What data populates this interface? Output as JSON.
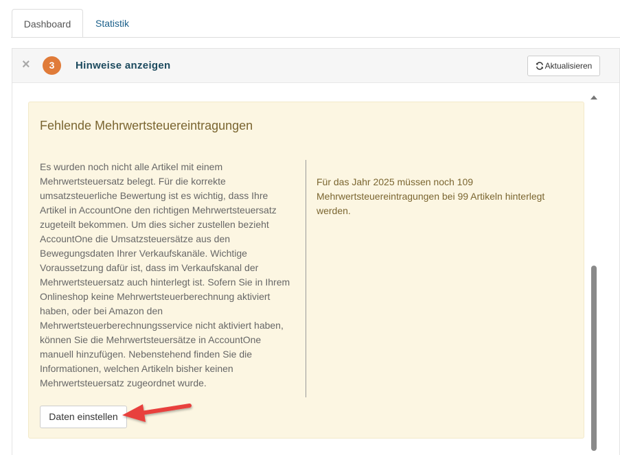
{
  "tabs": [
    {
      "label": "Dashboard",
      "active": true
    },
    {
      "label": "Statistik",
      "active": false
    }
  ],
  "panel": {
    "close_icon": "×",
    "badge_count": "3",
    "title": "Hinweise anzeigen",
    "refresh_label": "Aktualisieren"
  },
  "notice": {
    "title": "Fehlende Mehrwertsteuereintragungen",
    "body": "Es wurden noch nicht alle Artikel mit einem Mehrwertsteuersatz belegt. Für die korrekte umsatzsteuerliche Bewertung ist es wichtig, dass Ihre Artikel in AccountOne den richtigen Mehrwertsteuersatz zugeteilt bekommen. Um dies sicher zustellen bezieht AccountOne die Umsatzsteuersätze aus den Bewegungsdaten Ihrer Verkaufskanäle. Wichtige Voraussetzung dafür ist, dass im Verkaufskanal der Mehrwertsteuersatz auch hinterlegt ist. Sofern Sie in Ihrem Onlineshop keine Mehrwertsteuerberechnung aktiviert haben, oder bei Amazon den Mehrwertsteuerberechnungsservice nicht aktiviert haben, können Sie die Mehrwertsteuersätze in AccountOne manuell hinzufügen. Nebenstehend finden Sie die Informationen, welchen Artikeln bisher keinen Mehrwertsteuersatz zugeordnet wurde.",
    "info": "Für das Jahr 2025 müssen noch 109 Mehrwertsteuereintragungen bei 99 Artikeln hinterlegt werden.",
    "button_label": "Daten einstellen"
  },
  "colors": {
    "badge": "#e07b39",
    "notice_bg": "#fcf6e2",
    "notice_title": "#7a6530",
    "link": "#1a5f8a",
    "arrow": "#e8403c"
  },
  "icons": {
    "close": "close-icon",
    "refresh": "refresh-icon",
    "annotation": "red-arrow-annotation"
  }
}
